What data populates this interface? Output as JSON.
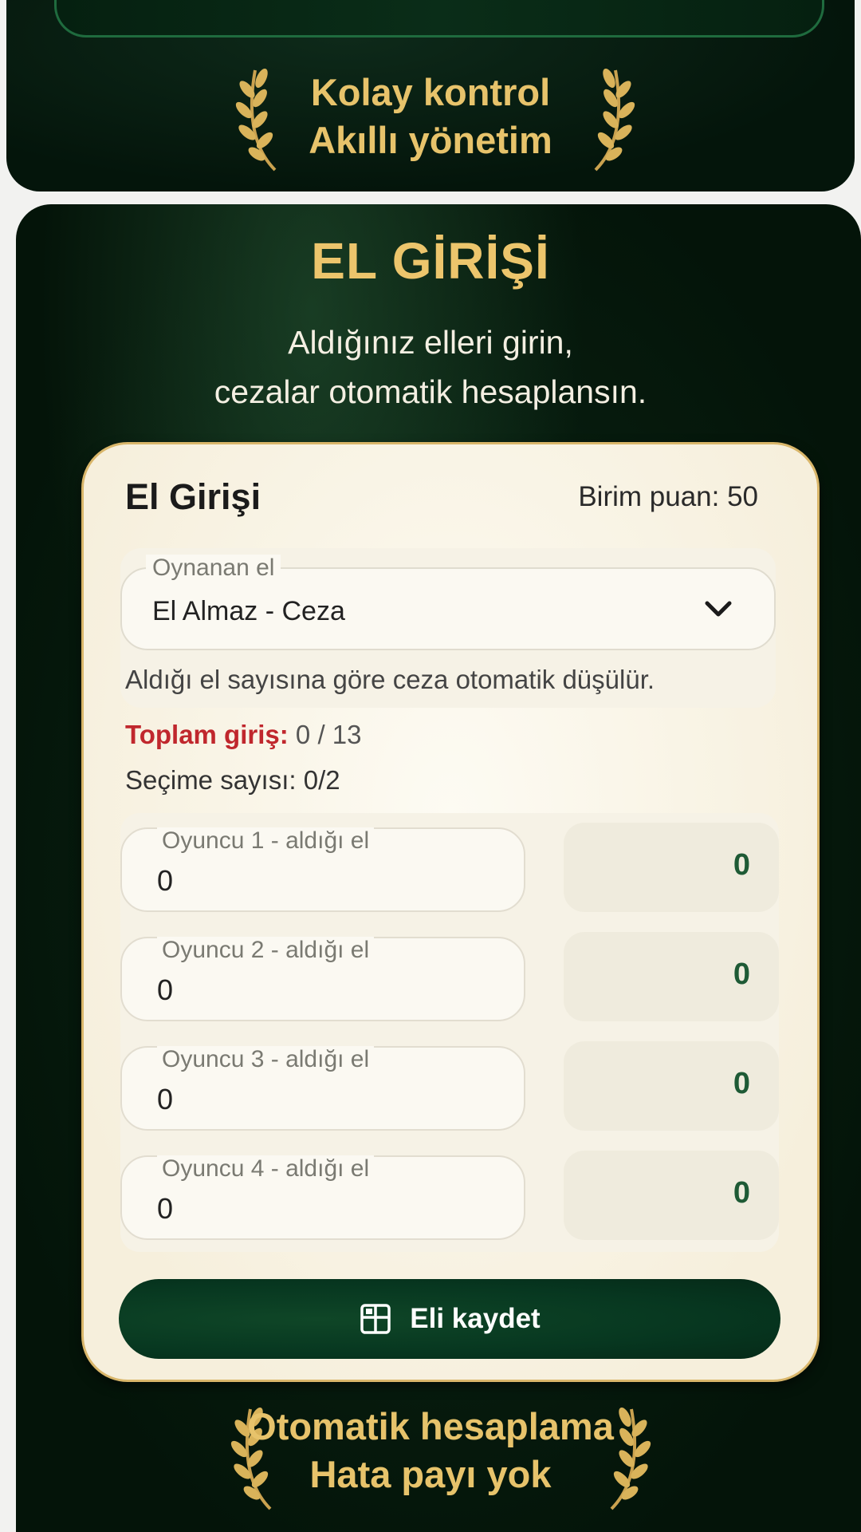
{
  "top_slogan": {
    "line1": "Kolay kontrol",
    "line2": "Akıllı yönetim"
  },
  "panel": {
    "title": "EL GİRİŞİ",
    "subtitle_line1": "Aldığınız elleri girin,",
    "subtitle_line2": "cezalar otomatik hesaplansın."
  },
  "card": {
    "title": "El Girişi",
    "unit_points": "Birim puan: 50",
    "select": {
      "legend": "Oynanan el",
      "value": "El Almaz - Ceza",
      "help": "Aldığı el sayısına göre ceza otomatik düşülür."
    },
    "total_label": "Toplam giriş:",
    "total_value": "0 / 13",
    "secim_label": "Seçime sayısı:",
    "secim_value": "0/2",
    "players": [
      {
        "label": "Oyuncu 1 - aldığı el",
        "value": "0",
        "penalty": "0"
      },
      {
        "label": "Oyuncu 2 - aldığı el",
        "value": "0",
        "penalty": "0"
      },
      {
        "label": "Oyuncu 3 - aldığı el",
        "value": "0",
        "penalty": "0"
      },
      {
        "label": "Oyuncu 4 - aldığı el",
        "value": "0",
        "penalty": "0"
      }
    ],
    "save_label": "Eli kaydet"
  },
  "bottom_slogan": {
    "line1": "Otomatik hesaplama",
    "line2": "Hata payı yok"
  },
  "colors": {
    "gold": "#e7c36b",
    "dark_green": "#041409",
    "button_green": "#073720",
    "total_red": "#c0272d",
    "penalty_green": "#1e5a35"
  },
  "icons": {
    "select_arrow": "chevron-down-icon",
    "save": "save-grid-icon",
    "laurel": "laurel-icon"
  }
}
